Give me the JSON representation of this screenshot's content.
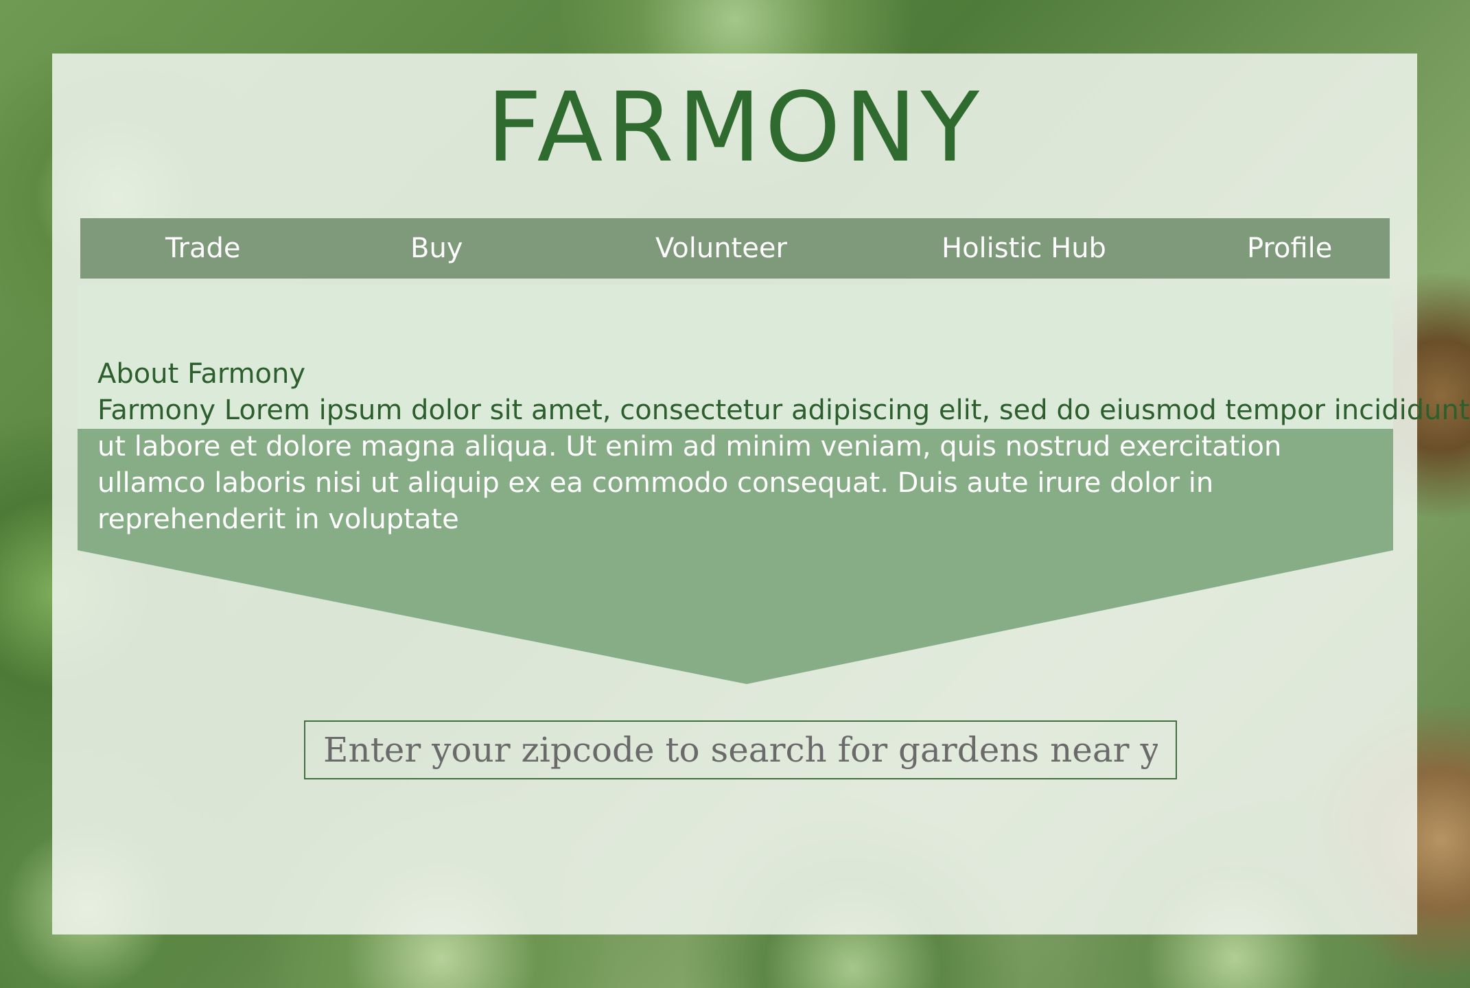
{
  "brand": {
    "title": "FARMONY"
  },
  "nav": {
    "items": [
      {
        "label": "Trade"
      },
      {
        "label": "Buy"
      },
      {
        "label": "Volunteer"
      },
      {
        "label": "Holistic Hub"
      },
      {
        "label": "Profile"
      }
    ]
  },
  "about": {
    "heading": "About Farmony",
    "body_line1": "Farmony Lorem ipsum dolor sit amet, consectetur adipiscing elit, sed do eiusmod tempor incididunt",
    "body_rest": "ut labore et dolore magna aliqua. Ut enim ad minim veniam, quis nostrud exercitation ullamco laboris nisi ut aliquip ex ea commodo consequat. Duis aute irure dolor in reprehenderit in voluptate"
  },
  "search": {
    "placeholder": "Enter your zipcode to search for gardens near you ....",
    "value": ""
  },
  "colors": {
    "title": "#2f6b2f",
    "navbar": "#7f9a7b",
    "about_top": "#dcebd9",
    "about_arrow": "#86ad86",
    "panel": "#eef4ec"
  }
}
